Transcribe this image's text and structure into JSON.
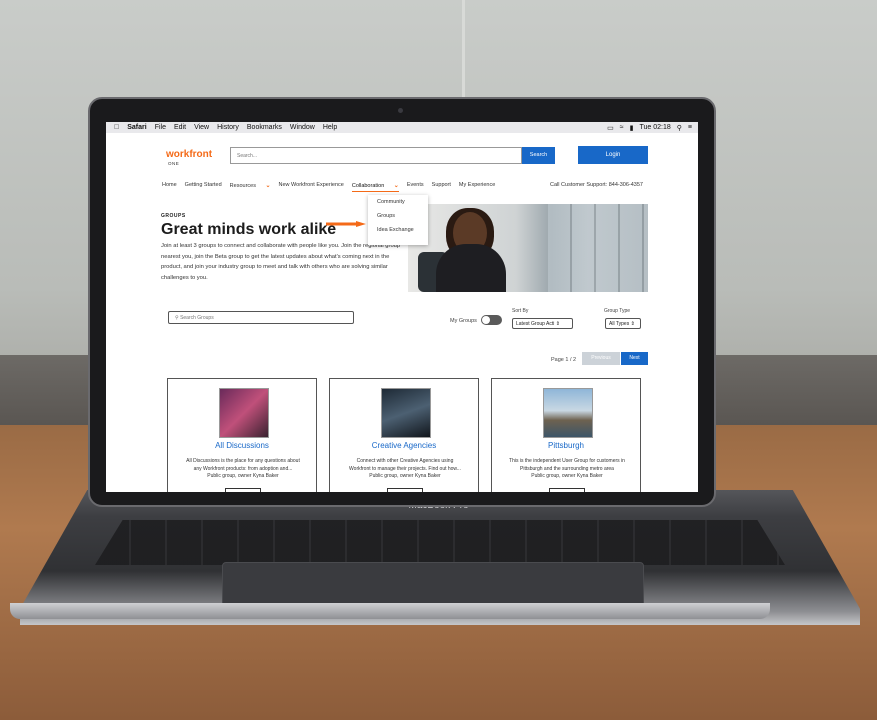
{
  "device_label": "MacBook Pro",
  "menubar": {
    "apple": "",
    "items": [
      "Safari",
      "File",
      "Edit",
      "View",
      "History",
      "Bookmarks",
      "Window",
      "Help"
    ],
    "clock": "Tue 02:18"
  },
  "site": {
    "logo": "workfront",
    "logo_sub": "ONE",
    "search_placeholder": "Search...",
    "search_button": "Search",
    "login_button": "Login",
    "nav": {
      "home": "Home",
      "getting_started": "Getting Started",
      "resources": "Resources",
      "new_experience": "New Workfront Experience",
      "collaboration": "Collaboration",
      "events": "Events",
      "support": "Support",
      "my_experience": "My Experience",
      "customer_support": "Call Customer Support: 844-306-4357"
    },
    "dropdown": [
      "Community",
      "Groups",
      "Idea Exchange"
    ]
  },
  "hero": {
    "eyebrow": "GROUPS",
    "headline": "Great minds work alike",
    "intro": "Join at least 3 groups to connect and collaborate with people like you. Join the regional group nearest you, join the Beta group to get the latest updates about what's coming next in the product, and join your industry group to meet and talk with others who are solving similar challenges to you."
  },
  "filters": {
    "search_placeholder": "Search Groups",
    "my_groups_label": "My Groups",
    "sort_label": "Sort By",
    "sort_value": "Latest Group Acti",
    "type_label": "Group Type",
    "type_value": "All Types"
  },
  "pagination": {
    "page_label": "Page 1 / 2",
    "previous": "Previous",
    "next": "Next"
  },
  "cards": [
    {
      "title": "All Discussions",
      "desc1": "All Discussions is the place for any questions about",
      "desc2": "any Workfront products: from adoption and...",
      "desc3": "Public group, owner  Kyna Baker"
    },
    {
      "title": "Creative Agencies",
      "desc1": "Connect with other Creative Agencies using",
      "desc2": "Workfront to manage their projects. Find out how...",
      "desc3": "Public group, owner  Kyna Baker"
    },
    {
      "title": "Pittsburgh",
      "desc1": "This is the independent User Group for customers in",
      "desc2": "Pittsburgh and the surrounding metro area",
      "desc3": "Public group, owner  Kyna Baker"
    }
  ],
  "colors": {
    "brand_orange": "#f46a18",
    "brand_blue": "#1868c8"
  }
}
